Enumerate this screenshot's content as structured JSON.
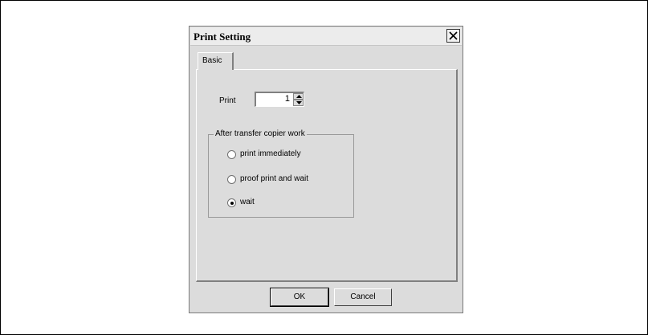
{
  "dialog": {
    "title": "Print Setting",
    "tab_label": "Basic"
  },
  "print": {
    "label": "Print",
    "copies": "1"
  },
  "after_transfer": {
    "group_label": "After transfer copier work",
    "options": [
      {
        "label": "print immediately",
        "selected": false
      },
      {
        "label": "proof print and wait",
        "selected": false
      },
      {
        "label": "wait",
        "selected": true
      }
    ]
  },
  "buttons": {
    "ok": "OK",
    "cancel": "Cancel"
  },
  "icons": {
    "close": "close-icon",
    "spin_up": "arrow-up-icon",
    "spin_down": "arrow-down-icon"
  }
}
